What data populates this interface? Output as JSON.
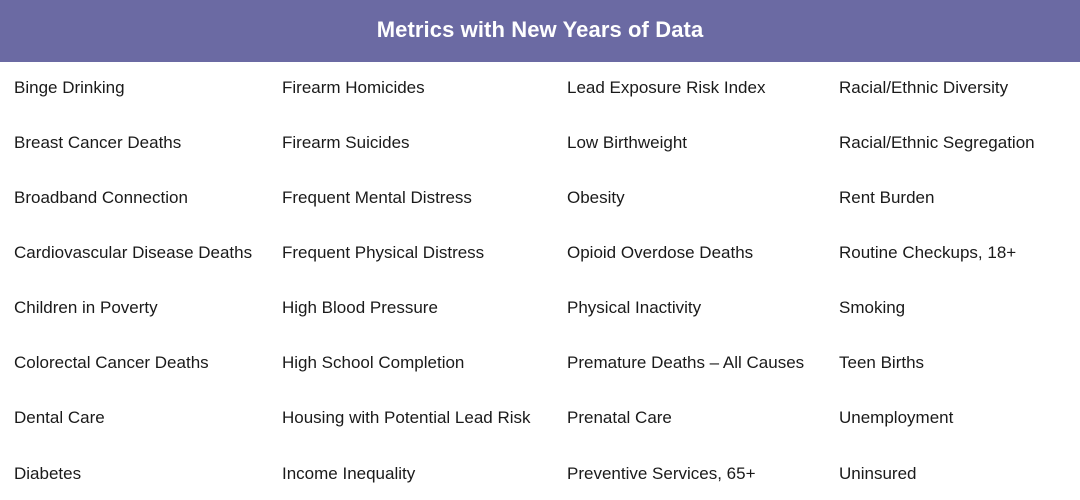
{
  "header": {
    "title": "Metrics with New Years of Data",
    "background_color": "#6b6aa3",
    "text_color": "#ffffff"
  },
  "columns": [
    {
      "items": [
        "Binge Drinking",
        "Breast Cancer Deaths",
        "Broadband Connection",
        "Cardiovascular Disease Deaths",
        "Children in Poverty",
        "Colorectal Cancer Deaths",
        "Dental Care",
        "Diabetes"
      ]
    },
    {
      "items": [
        "Firearm Homicides",
        "Firearm Suicides",
        "Frequent Mental Distress",
        "Frequent Physical Distress",
        "High Blood Pressure",
        "High School Completion",
        "Housing with Potential Lead Risk",
        "Income Inequality"
      ]
    },
    {
      "items": [
        "Lead Exposure Risk Index",
        "Low Birthweight",
        "Obesity",
        "Opioid Overdose Deaths",
        "Physical Inactivity",
        "Premature Deaths – All Causes",
        "Prenatal Care",
        "Preventive Services, 65+"
      ]
    },
    {
      "items": [
        "Racial/Ethnic Diversity",
        "Racial/Ethnic Segregation",
        "Rent Burden",
        "Routine Checkups, 18+",
        "Smoking",
        "Teen Births",
        "Unemployment",
        "Uninsured"
      ]
    }
  ]
}
